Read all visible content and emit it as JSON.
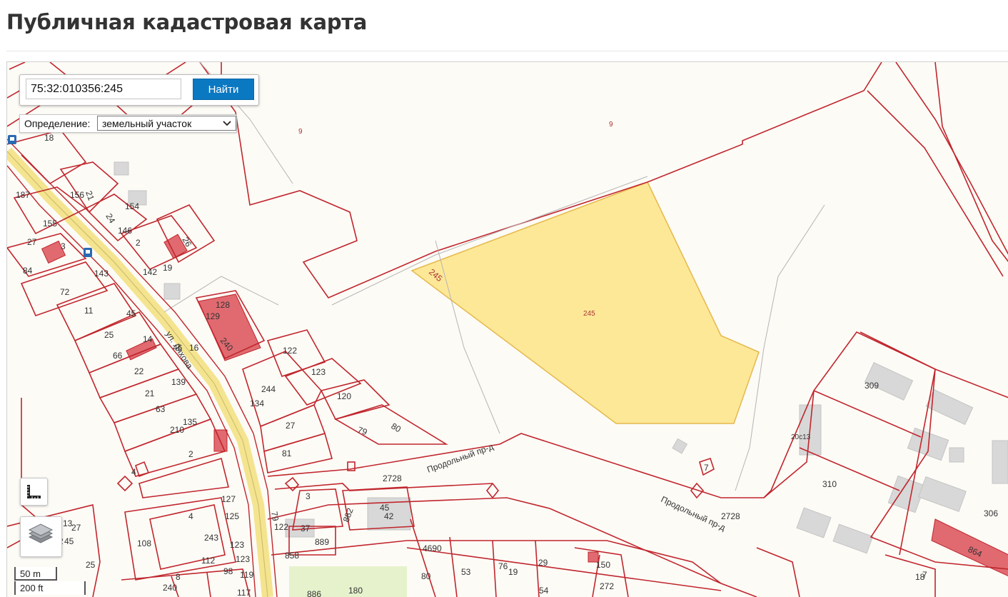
{
  "page": {
    "title": "Публичная кадастровая карта"
  },
  "search": {
    "value": "75:32:010356:245",
    "button_label": "Найти"
  },
  "definition": {
    "label": "Определение:",
    "selected": "земельный участок"
  },
  "scale": {
    "metric": "50 m",
    "imperial": "200 ft"
  },
  "map": {
    "highlight_color": "#fde58e",
    "parcel_line_color": "#c0262d",
    "road_color": "#fbf1a8",
    "selected_parcel": "245",
    "streets": [
      {
        "id": "ul-lyakhova",
        "label": "ул. Ляхова"
      },
      {
        "id": "prodolny-1",
        "label": "Продольный пр-д"
      },
      {
        "id": "prodolny-2",
        "label": "Продольный пр-д"
      }
    ],
    "labels": [
      "9",
      "9",
      "18",
      "21",
      "156",
      "24",
      "154",
      "187",
      "146",
      "26",
      "155",
      "2",
      "27",
      "3",
      "84",
      "19",
      "142",
      "143",
      "72",
      "245",
      "128",
      "129",
      "240",
      "11",
      "45",
      "25",
      "14",
      "16",
      "46",
      "122",
      "66",
      "22",
      "244",
      "123",
      "21",
      "139",
      "120",
      "134",
      "80",
      "79",
      "63",
      "135",
      "27",
      "210",
      "81",
      "309",
      "20с13",
      "2",
      "4",
      "2728",
      "7",
      "310",
      "3",
      "127",
      "882",
      "42",
      "45",
      "306",
      "4",
      "13",
      "27",
      "125",
      "108",
      "243",
      "37",
      "79",
      "122",
      "889",
      "858",
      "123",
      "2728",
      "1092",
      "45",
      "25",
      "112",
      "4690",
      "123",
      "98",
      "119",
      "150",
      "76",
      "19",
      "29",
      "53",
      "80",
      "8",
      "240",
      "272",
      "180",
      "117",
      "54",
      "864",
      "18",
      "7",
      "886"
    ]
  }
}
